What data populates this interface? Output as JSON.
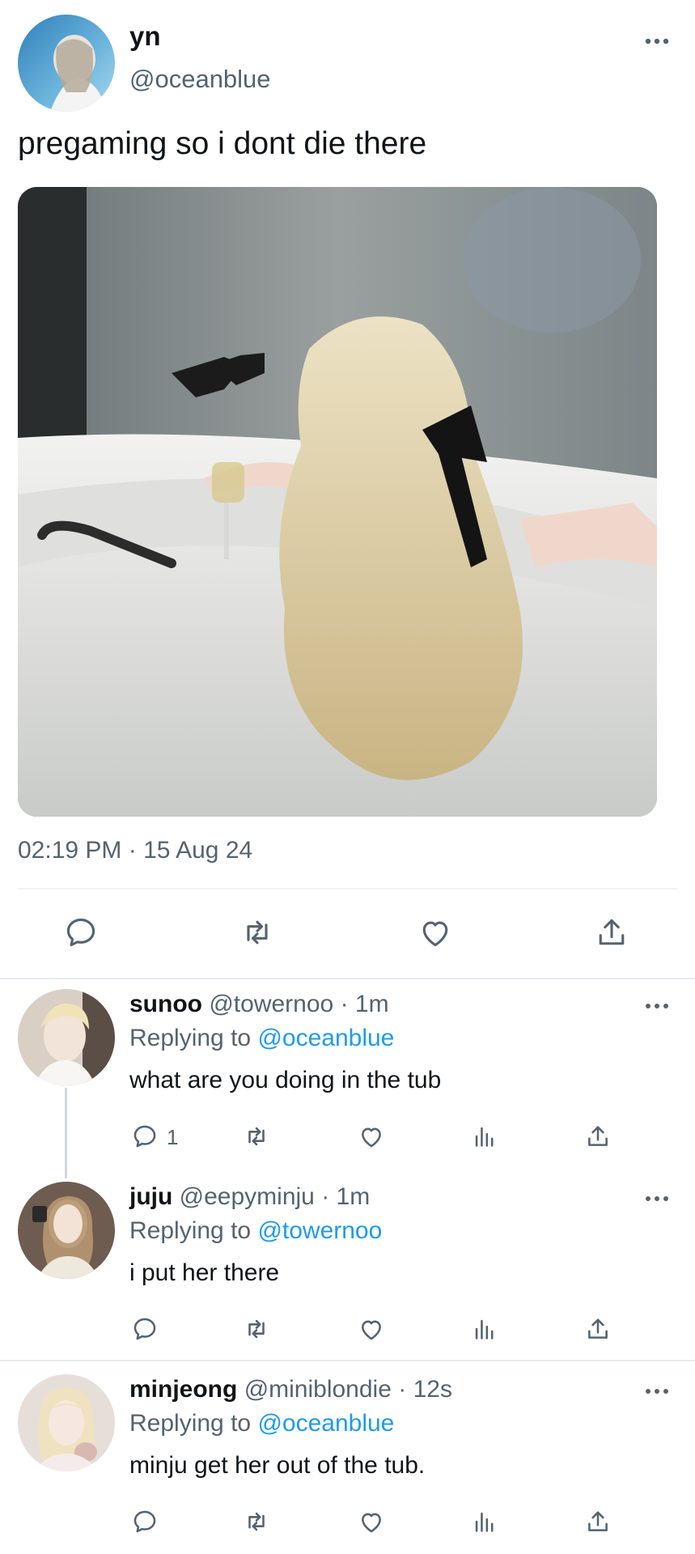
{
  "main_tweet": {
    "display_name": "yn",
    "handle": "@oceanblue",
    "text": "pregaming so i dont die there",
    "timestamp": "02:19 PM · 15 Aug 24",
    "more_icon": "more-dots-icon",
    "actions": [
      "reply-icon",
      "retweet-icon",
      "like-icon",
      "share-icon"
    ]
  },
  "replies": [
    {
      "display_name": "sunoo",
      "handle": "@towernoo",
      "time": "· 1m",
      "replying_prefix": "Replying to",
      "replying_to": "@oceanblue",
      "text": "what are you doing in the tub",
      "reply_count": "1"
    },
    {
      "display_name": "juju",
      "handle": "@eepyminju",
      "time": "· 1m",
      "replying_prefix": "Replying to",
      "replying_to": "@towernoo",
      "text": "i put her there",
      "reply_count": ""
    },
    {
      "display_name": "minjeong",
      "handle": "@miniblondie",
      "time": "· 12s",
      "replying_prefix": "Replying to",
      "replying_to": "@oceanblue",
      "text": "minju get her out of the tub.",
      "reply_count": ""
    }
  ],
  "colors": {
    "text": "#0f1419",
    "muted": "#536471",
    "link": "#1d9bf0",
    "divider": "#eff3f4"
  }
}
